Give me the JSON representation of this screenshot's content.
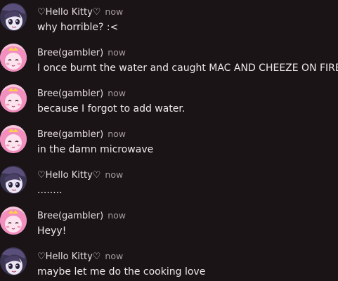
{
  "messages": [
    {
      "author": "♡Hello Kitty♡",
      "avatar_icon": "dark-anime-avatar",
      "timestamp": "now",
      "text": "why horrible? :<"
    },
    {
      "author": "Bree(gambler)",
      "avatar_icon": "pink-princess-avatar",
      "timestamp": "now",
      "text": "I once burnt the water and caught MAC AND CHEEZE ON FIRE"
    },
    {
      "author": "Bree(gambler)",
      "avatar_icon": "pink-princess-avatar",
      "timestamp": "now",
      "text": "because I forgot to add water."
    },
    {
      "author": "Bree(gambler)",
      "avatar_icon": "pink-princess-avatar",
      "timestamp": "now",
      "text": "in the damn microwave"
    },
    {
      "author": "♡Hello Kitty♡",
      "avatar_icon": "dark-anime-avatar",
      "timestamp": "now",
      "text": "........"
    },
    {
      "author": "Bree(gambler)",
      "avatar_icon": "pink-princess-avatar",
      "timestamp": "now",
      "text": "Heyy!"
    },
    {
      "author": "♡Hello Kitty♡",
      "avatar_icon": "dark-anime-avatar",
      "timestamp": "now",
      "text": "maybe let me do the cooking love"
    }
  ],
  "colors": {
    "background": "#1a1416",
    "author_text": "#e6dde0",
    "timestamp_text": "#a79ca0",
    "message_text": "#efe8ea"
  }
}
